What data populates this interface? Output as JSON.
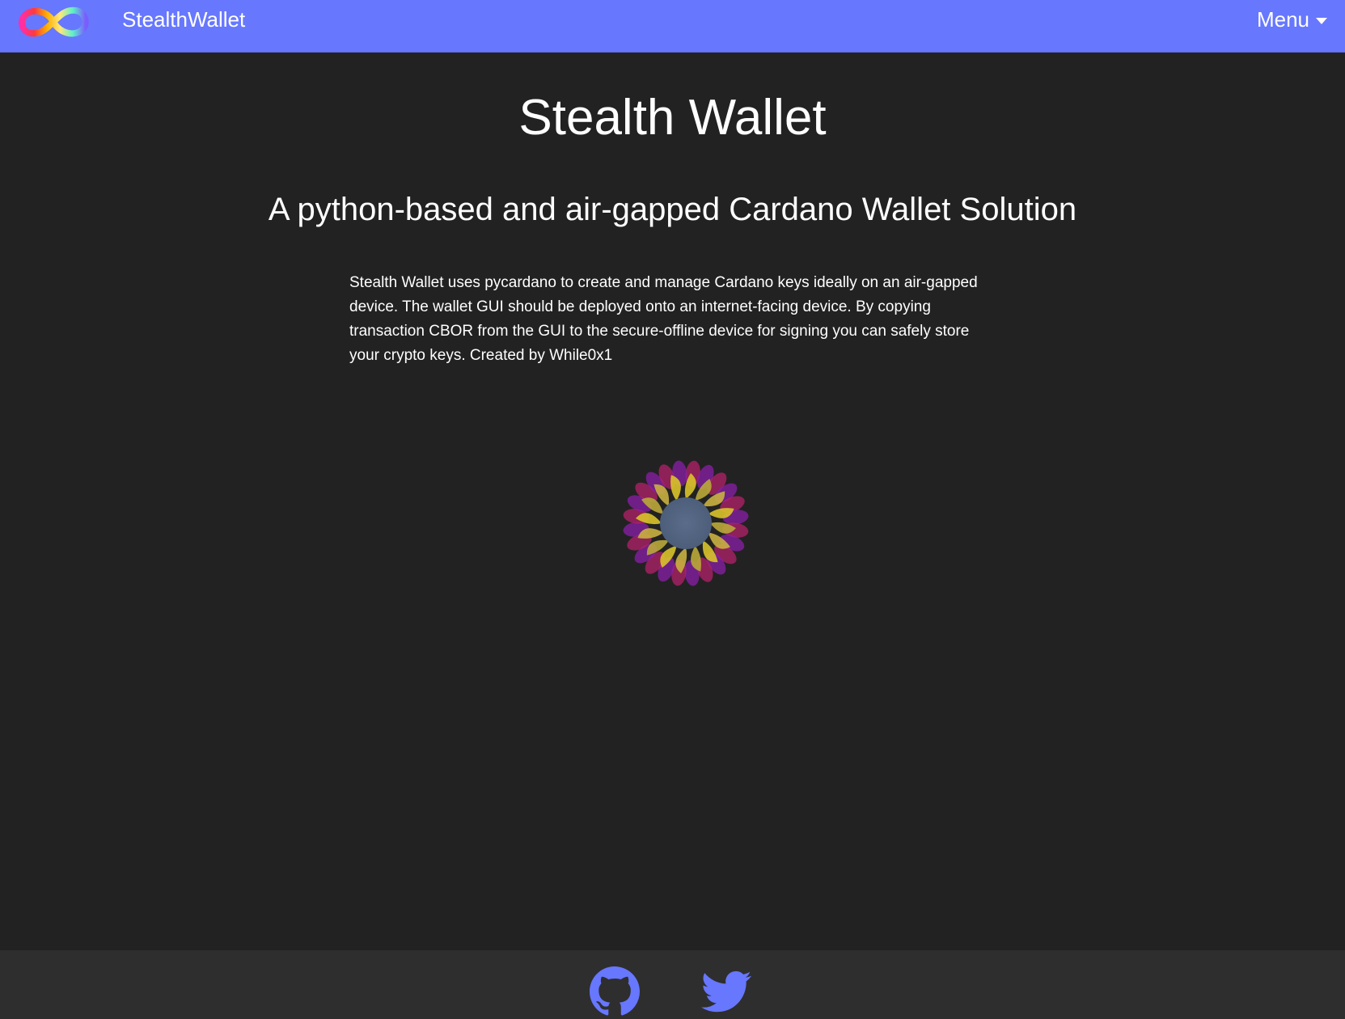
{
  "navbar": {
    "brand_name": "StealthWallet",
    "logo_icon": "infinity-logo-icon",
    "menu_label": "Menu",
    "menu_icon": "caret-down-icon",
    "background_color": "#6777fe"
  },
  "hero": {
    "title": "Stealth Wallet",
    "subtitle": "A python-based and air-gapped Cardano Wallet Solution",
    "description": "Stealth Wallet uses pycardano to create and manage Cardano keys ideally on an air-gapped device. The wallet GUI should be deployed onto an internet-facing device. By copying transaction CBOR from the GUI to the secure-offline device for signing you can safely store your crypto keys. Created by While0x1"
  },
  "spinner": {
    "icon": "loading-spinner-icon"
  },
  "footer": {
    "links": [
      {
        "icon": "github-icon"
      },
      {
        "icon": "twitter-icon"
      }
    ],
    "icon_color": "#6777fe"
  },
  "colors": {
    "page_background": "#222222",
    "footer_background": "#2e2e2e",
    "text": "#ffffff"
  }
}
